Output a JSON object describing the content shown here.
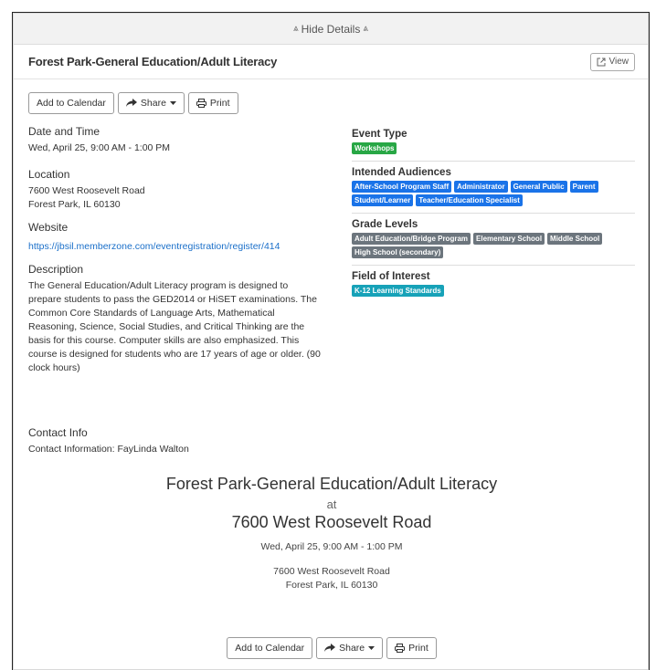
{
  "hide_bar": {
    "label": "Hide Details",
    "chevron_glyph": "«"
  },
  "event": {
    "title": "Forest Park-General Education/Adult Literacy",
    "view_label": "View"
  },
  "toolbar": {
    "add_calendar": "Add to Calendar",
    "share": "Share",
    "print": "Print"
  },
  "details": {
    "date_label": "Date and Time",
    "date_value": "Wed, April 25, 9:00 AM - 1:00 PM",
    "location_label": "Location",
    "location_line1": "7600 West Roosevelt Road",
    "location_line2": "Forest Park, IL 60130",
    "website_label": "Website",
    "website_url": "https://jbsil.memberzone.com/eventregistration/register/414",
    "description_label": "Description",
    "description_text": "The General Education/Adult Literacy program is designed to prepare students to pass the GED2014 or HiSET examinations.  The Common Core Standards of Language Arts, Mathematical Reasoning, Science, Social Studies, and Critical Thinking are the basis for this course.  Computer skills are also emphasized.  This course is designed for students who are 17 years of age or older.  (90 clock hours)",
    "contact_label": "Contact Info",
    "contact_value": "Contact Information: FayLinda Walton"
  },
  "right": {
    "event_type_label": "Event Type",
    "event_type_tags": [
      "Workshops"
    ],
    "audiences_label": "Intended Audiences",
    "audiences_tags": [
      "After-School Program Staff",
      "Administrator",
      "General Public",
      "Parent",
      "Student/Learner",
      "Teacher/Education Specialist"
    ],
    "grade_label": "Grade Levels",
    "grade_tags": [
      "Adult Education/Bridge Program",
      "Elementary School",
      "Middle School",
      "High School (secondary)"
    ],
    "field_label": "Field of Interest",
    "field_tags": [
      "K-12 Learning Standards"
    ]
  },
  "summary": {
    "title": "Forest Park-General Education/Adult Literacy",
    "at": "at",
    "location": "7600 West Roosevelt Road",
    "date": "Wed, April 25, 9:00 AM - 1:00 PM",
    "addr_line1": "7600 West Roosevelt Road",
    "addr_line2": "Forest Park, IL 60130"
  },
  "colors": {
    "link": "#1a6fc9",
    "tag_green": "#28a745",
    "tag_blue": "#1a73e8",
    "tag_gray": "#6c757d",
    "tag_teal": "#17a2b8"
  }
}
